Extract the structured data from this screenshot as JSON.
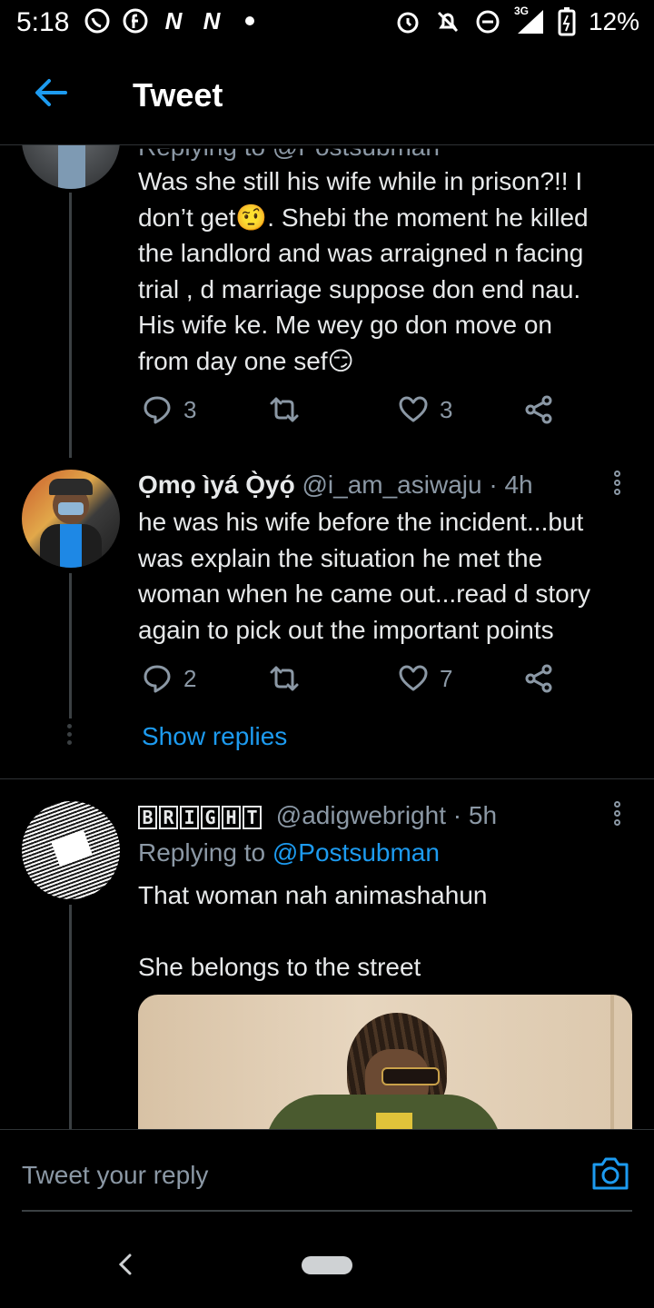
{
  "status_bar": {
    "time": "5:18",
    "left_icons": [
      "whatsapp-icon",
      "facebook-icon",
      "news-icon",
      "news-icon",
      "dot-icon"
    ],
    "network": "3G",
    "battery": "12%"
  },
  "header": {
    "title": "Tweet"
  },
  "tweets": [
    {
      "reply_to_partial": "Replying to @Postsubman",
      "text_lines": [
        "Was she still his wife while in prison?!! I",
        "don’t get🤨. Shebi the moment he killed",
        "the landlord and was arraigned n facing",
        "trial , d marriage suppose don end nau.",
        "His wife ke. Me wey go don move on",
        "from day one sef😏"
      ],
      "actions": {
        "replies": "3",
        "likes": "3"
      }
    },
    {
      "name": "Ọmọ ìyá Ọ̀yọ́",
      "handle": "@i_am_asiwaju",
      "time": "· 4h",
      "text_lines": [
        "he was his wife before the incident...but",
        "was explain the situation he met the",
        "woman when he came out...read d story",
        "again to pick out the important points"
      ],
      "actions": {
        "replies": "2",
        "likes": "7"
      },
      "show_replies": "Show replies"
    },
    {
      "name_letters": [
        "B",
        "R",
        "I",
        "G",
        "H",
        "T"
      ],
      "handle": "@adigwebright",
      "time": "· 5h",
      "replying_to_prefix": "Replying to ",
      "replying_to_user": "@Postsubman",
      "text_line1": "That woman nah animashahun",
      "text_line2": "She belongs to the street"
    }
  ],
  "reply_bar": {
    "placeholder": "Tweet your reply"
  },
  "colors": {
    "accent": "#1d9bf0",
    "background": "#000000",
    "muted": "#8b98a5"
  }
}
